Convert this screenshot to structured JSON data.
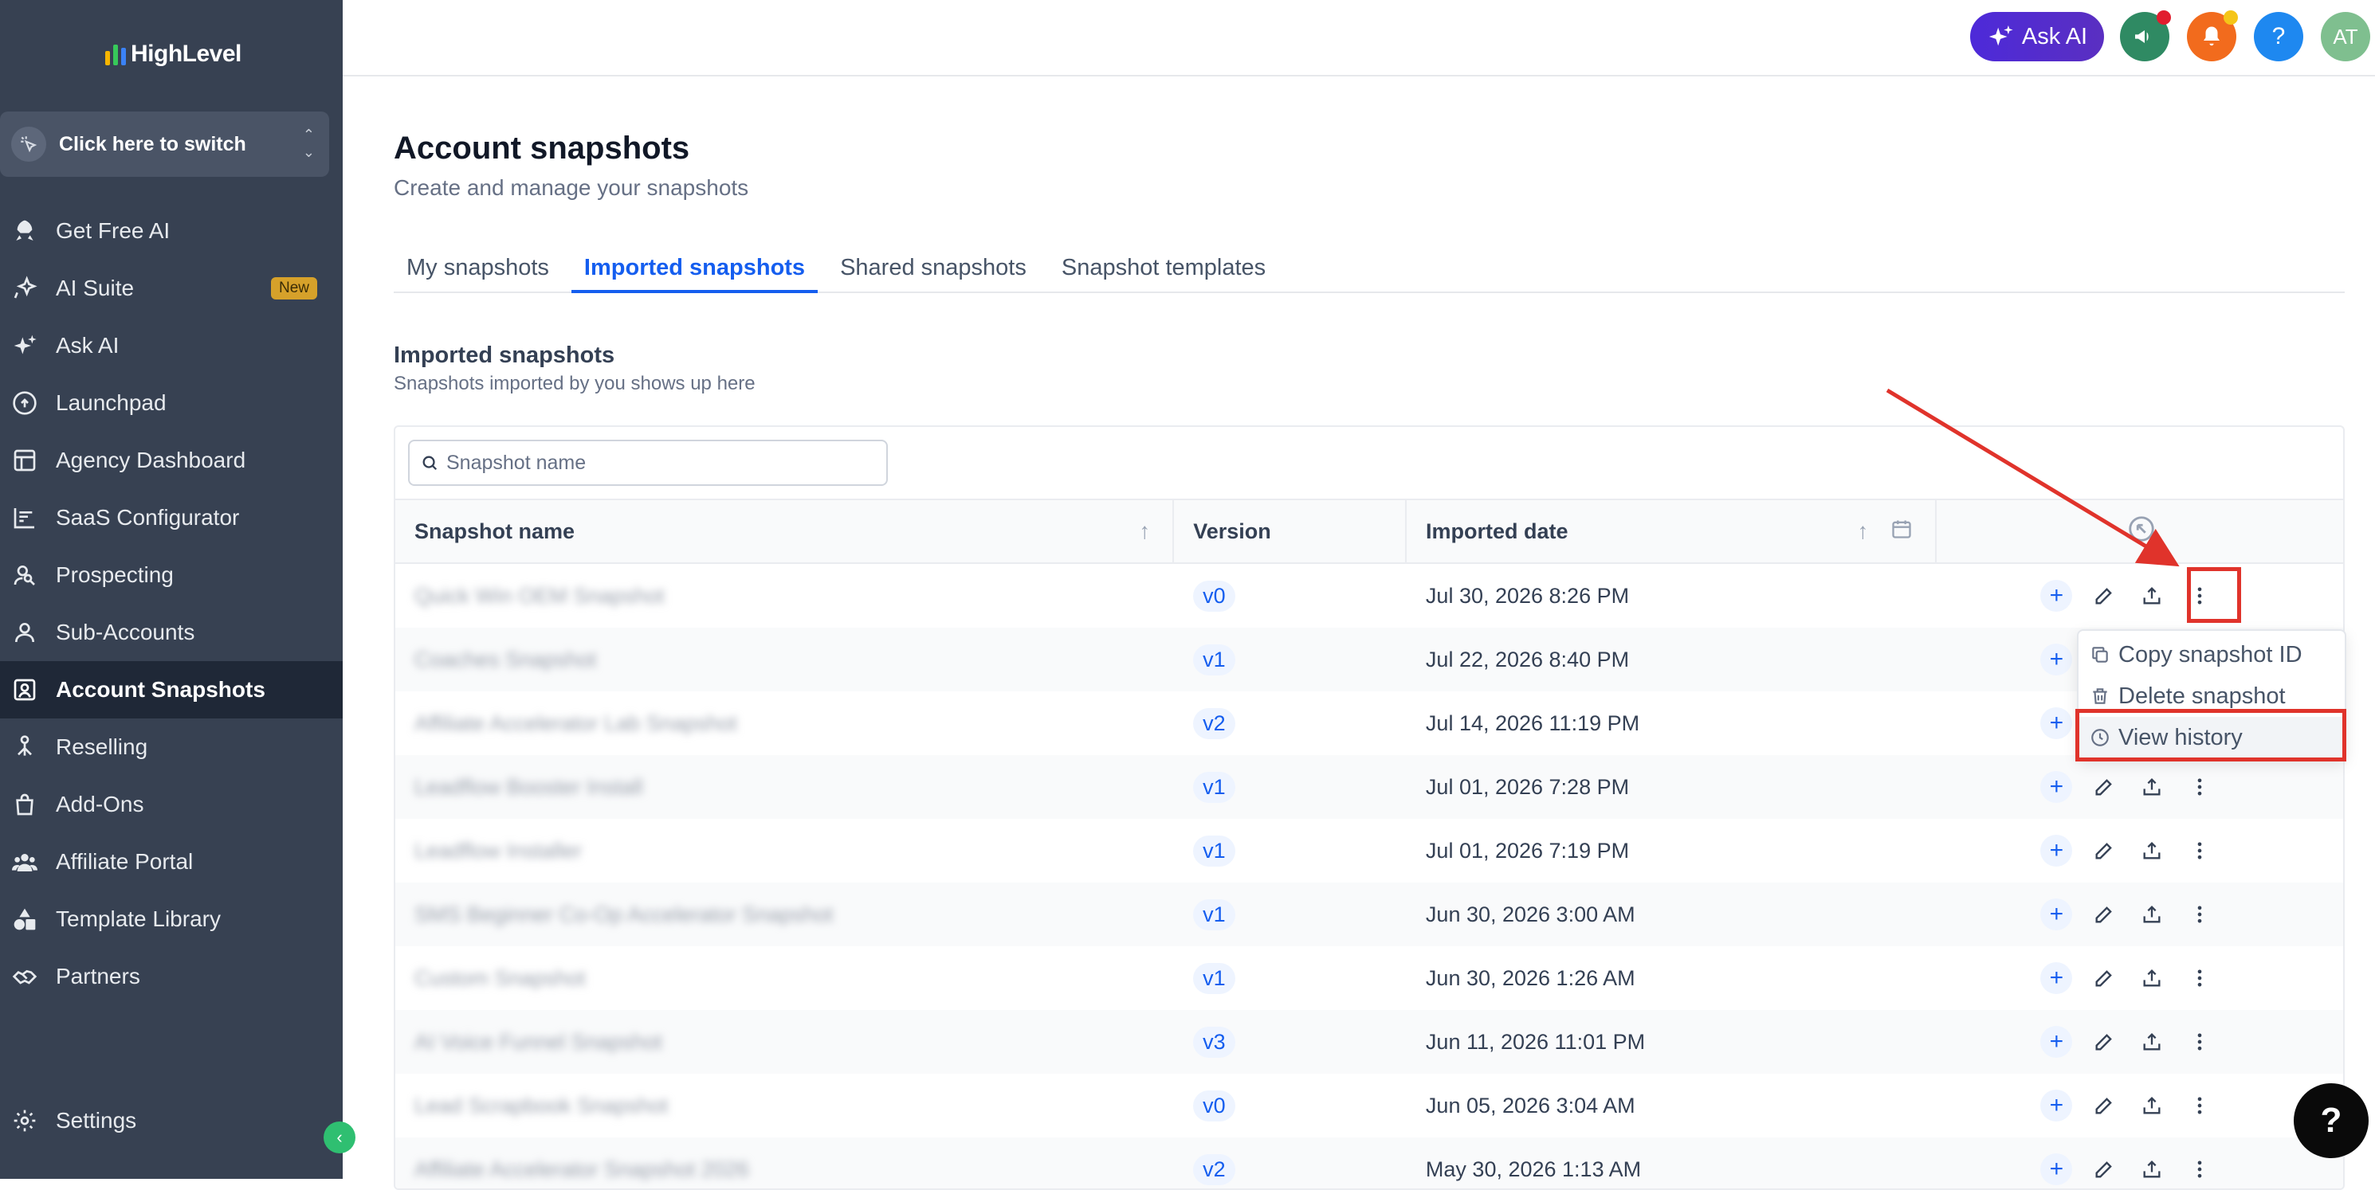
{
  "brand": {
    "name": "HighLevel"
  },
  "switcher": {
    "label": "Click here to switch"
  },
  "sidebar": {
    "items": [
      {
        "label": "Get Free AI",
        "icon": "rocket-icon"
      },
      {
        "label": "AI Suite",
        "icon": "sparkle-icon",
        "badge": "New"
      },
      {
        "label": "Ask AI",
        "icon": "sparkles-icon"
      },
      {
        "label": "Launchpad",
        "icon": "cloud-upload-icon"
      },
      {
        "label": "Agency Dashboard",
        "icon": "dashboard-icon"
      },
      {
        "label": "SaaS Configurator",
        "icon": "chart-icon"
      },
      {
        "label": "Prospecting",
        "icon": "user-search-icon"
      },
      {
        "label": "Sub-Accounts",
        "icon": "user-icon"
      },
      {
        "label": "Account Snapshots",
        "icon": "snapshot-icon",
        "active": true
      },
      {
        "label": "Reselling",
        "icon": "network-icon"
      },
      {
        "label": "Add-Ons",
        "icon": "bag-icon"
      },
      {
        "label": "Affiliate Portal",
        "icon": "users-icon"
      },
      {
        "label": "Template Library",
        "icon": "shapes-icon"
      },
      {
        "label": "Partners",
        "icon": "handshake-icon"
      }
    ],
    "settings": "Settings"
  },
  "topbar": {
    "ask_ai": "Ask AI",
    "avatar": "AT",
    "help": "?"
  },
  "page": {
    "title": "Account snapshots",
    "subtitle": "Create and manage your snapshots"
  },
  "tabs": [
    "My snapshots",
    "Imported snapshots",
    "Shared snapshots",
    "Snapshot templates"
  ],
  "section": {
    "title": "Imported snapshots",
    "subtitle": "Snapshots imported by you shows up here"
  },
  "search": {
    "placeholder": "Snapshot name"
  },
  "table": {
    "headers": {
      "name": "Snapshot name",
      "version": "Version",
      "date": "Imported date"
    },
    "rows": [
      {
        "name": "Quick Win OEM Snapshot",
        "version": "v0",
        "date": "Jul 30, 2026 8:26 PM"
      },
      {
        "name": "Coaches Snapshot",
        "version": "v1",
        "date": "Jul 22, 2026 8:40 PM"
      },
      {
        "name": "Affiliate Accelerator Lab Snapshot",
        "version": "v2",
        "date": "Jul 14, 2026 11:19 PM"
      },
      {
        "name": "Leadflow Booster Install",
        "version": "v1",
        "date": "Jul 01, 2026 7:28 PM"
      },
      {
        "name": "Leadflow Installer",
        "version": "v1",
        "date": "Jul 01, 2026 7:19 PM"
      },
      {
        "name": "SMS Beginner Co-Op Accelerator Snapshot",
        "version": "v1",
        "date": "Jun 30, 2026 3:00 AM"
      },
      {
        "name": "Custom Snapshot",
        "version": "v1",
        "date": "Jun 30, 2026 1:26 AM"
      },
      {
        "name": "AI Voice Funnel Snapshot",
        "version": "v3",
        "date": "Jun 11, 2026 11:01 PM"
      },
      {
        "name": "Lead Scrapbook Snapshot",
        "version": "v0",
        "date": "Jun 05, 2026 3:04 AM"
      },
      {
        "name": "Affiliate Accelerator Snapshot 2026",
        "version": "v2",
        "date": "May 30, 2026 1:13 AM"
      }
    ]
  },
  "menu": {
    "items": [
      "Copy snapshot ID",
      "Delete snapshot",
      "View history"
    ]
  },
  "colors": {
    "accent": "#155eef",
    "sidebar_bg": "#374152",
    "highlight": "#e0332b"
  }
}
